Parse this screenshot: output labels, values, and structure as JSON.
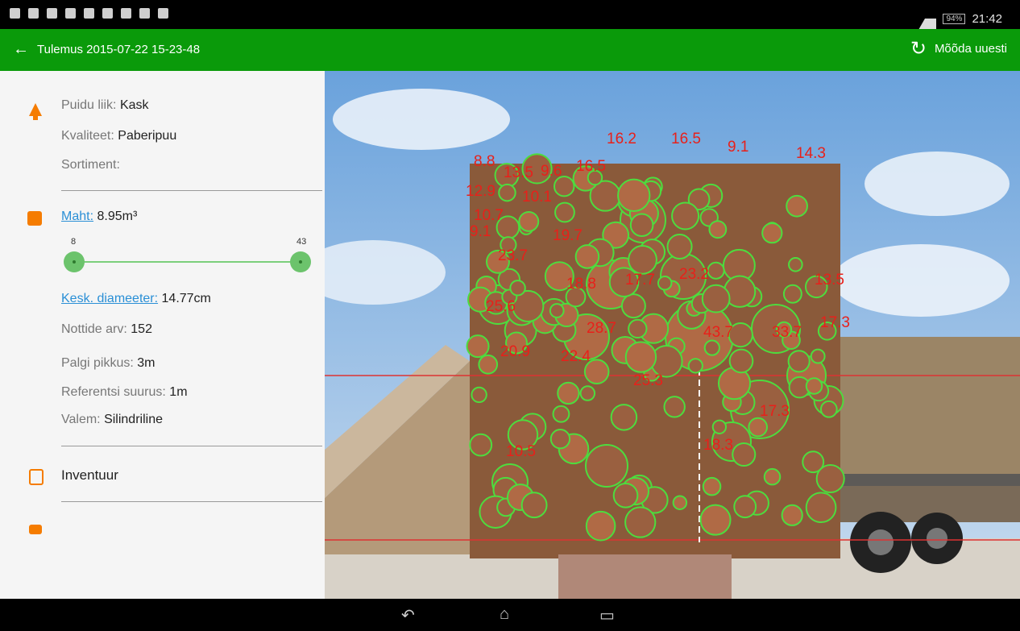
{
  "status_bar": {
    "time": "21:42",
    "battery": "94%",
    "icons": [
      "notification-icon",
      "image-icon",
      "sd-card-icon",
      "download-icon",
      "signal-icon",
      "flag-icon",
      "bluetooth-icon",
      "sync-icon",
      "check-icon"
    ]
  },
  "app_bar": {
    "title": "Tulemus 2015-07-22 15-23-48",
    "remeasure_label": "Mõõda uuesti"
  },
  "info": {
    "wood_type_label": "Puidu liik:",
    "wood_type_value": "Kask",
    "quality_label": "Kvaliteet:",
    "quality_value": "Paberipuu",
    "assortment_label": "Sortiment:",
    "volume_label": "Maht:",
    "volume_value": "8.95m³",
    "slider_min": "8",
    "slider_max": "43",
    "diameter_label": "Kesk. diameeter:",
    "diameter_value": "14.77cm",
    "log_count_label": "Nottide arv:",
    "log_count_value": "152",
    "log_length_label": "Palgi pikkus:",
    "log_length_value": "3m",
    "reference_label": "Referentsi suurus:",
    "reference_value": "1m",
    "formula_label": "Valem:",
    "formula_value": "Silindriline",
    "inventory_label": "Inventuur"
  },
  "photo": {
    "labels": [
      "16.2",
      "16.5",
      "8.8",
      "9.1",
      "14.3",
      "13.5",
      "9.6",
      "16.5",
      "12.9",
      "10.1",
      "10.7",
      "9.1",
      "23.7",
      "19.7",
      "25.6",
      "18.8",
      "17.7",
      "23.2",
      "28.7",
      "43.7",
      "33.7",
      "17.3",
      "20.9",
      "22.4",
      "25.3",
      "18.3",
      "17.3",
      "10.5",
      "13.5"
    ]
  }
}
